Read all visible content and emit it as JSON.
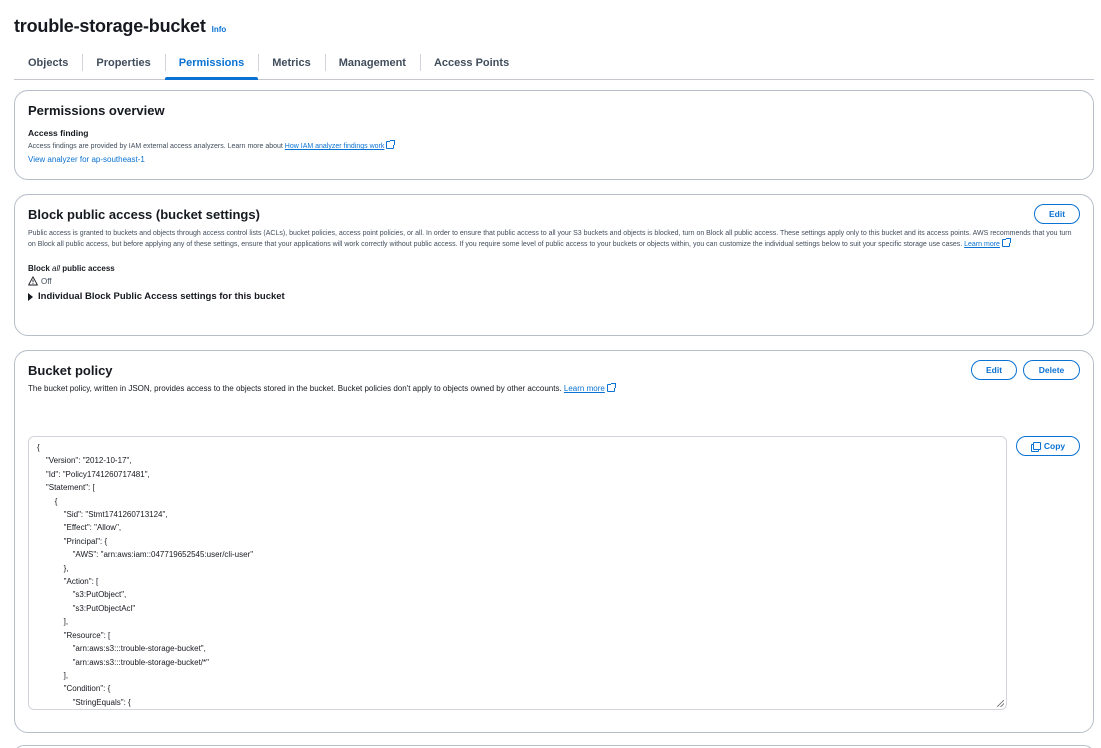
{
  "page": {
    "title": "trouble-storage-bucket",
    "info": "Info"
  },
  "tabs": [
    {
      "label": "Objects",
      "active": false
    },
    {
      "label": "Properties",
      "active": false
    },
    {
      "label": "Permissions",
      "active": true
    },
    {
      "label": "Metrics",
      "active": false
    },
    {
      "label": "Management",
      "active": false
    },
    {
      "label": "Access Points",
      "active": false
    }
  ],
  "permissions_overview": {
    "title": "Permissions overview",
    "access_finding_label": "Access finding",
    "access_finding_text": "Access findings are provided by IAM external access analyzers. Learn more about ",
    "access_finding_link": "How IAM analyzer findings work",
    "analyzer_link": "View analyzer for ap-southeast-1"
  },
  "block_public_access": {
    "title": "Block public access (bucket settings)",
    "edit_label": "Edit",
    "description": "Public access is granted to buckets and objects through access control lists (ACLs), bucket policies, access point policies, or all. In order to ensure that public access to all your S3 buckets and objects is blocked, turn on Block all public access. These settings apply only to this bucket and its access points. AWS recommends that you turn on Block all public access, but before applying any of these settings, ensure that your applications will work correctly without public access. If you require some level of public access to your buckets or objects within, you can customize the individual settings below to suit your specific storage use cases. ",
    "learn_more": "Learn more",
    "block_label_prefix": "Block ",
    "block_label_em": "all",
    "block_label_suffix": " public access",
    "status": "Off",
    "expander_label": "Individual Block Public Access settings for this bucket"
  },
  "bucket_policy": {
    "title": "Bucket policy",
    "edit_label": "Edit",
    "delete_label": "Delete",
    "copy_label": "Copy",
    "description": "The bucket policy, written in JSON, provides access to the objects stored in the bucket. Bucket policies don't apply to objects owned by other accounts. ",
    "learn_more": "Learn more",
    "code_lines": [
      "{",
      "    \"Version\": \"2012-10-17\",",
      "    \"Id\": \"Policy1741260717481\",",
      "    \"Statement\": [",
      "        {",
      "            \"Sid\": \"Stmt1741260713124\",",
      "            \"Effect\": \"Allow\",",
      "            \"Principal\": {",
      "                \"AWS\": \"arn:aws:iam::047719652545:user/cli-user\"",
      "            },",
      "            \"Action\": [",
      "                \"s3:PutObject\",",
      "                \"s3:PutObjectAcl\"",
      "            ],",
      "            \"Resource\": [",
      "                \"arn:aws:s3:::trouble-storage-bucket\",",
      "                \"arn:aws:s3:::trouble-storage-bucket/*\"",
      "            ],",
      "            \"Condition\": {",
      "                \"StringEquals\": {"
    ]
  },
  "colors": {
    "link": "#0972d3",
    "text": "#16191f",
    "border": "#b6bec9"
  }
}
